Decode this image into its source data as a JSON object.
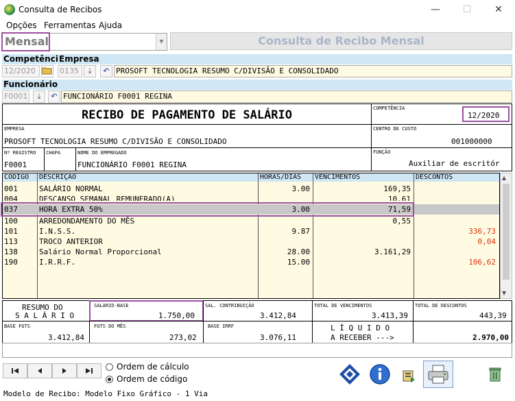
{
  "window": {
    "title": "Consulta de Recibos",
    "minimize": "—",
    "maximize": "☐",
    "close": "✕"
  },
  "menu": [
    "Opções",
    "Ferramentas",
    "Ajuda"
  ],
  "combo": {
    "value": "Mensal"
  },
  "banner": "Consulta de Recibo Mensal",
  "competencia": {
    "label": "Competência",
    "value": "12/2020"
  },
  "empresa": {
    "label": "Empresa",
    "code": "0135",
    "name": "PROSOFT TECNOLOGIA RESUMO C/DIVISÃO E CONSOLIDADO"
  },
  "funcionario": {
    "label": "Funcionário",
    "code": "F0001",
    "name": "FUNCIONÁRIO F0001 REGINA"
  },
  "recibo": {
    "title": "RECIBO DE PAGAMENTO DE SALÁRIO",
    "competencia_label": "COMPETÊNCIA",
    "competencia_value": "12/2020",
    "empresa_label": "EMPRESA",
    "empresa_value": "PROSOFT TECNOLOGIA RESUMO C/DIVISÃO E CONSOLIDADO",
    "centro_label": "CENTRO DE CUSTO",
    "centro_value": "001000000",
    "registro_label": "Nº REGISTRO",
    "registro_value": "F0001",
    "chapa_label": "CHAPA",
    "nome_label": "NOME DO EMPREGADO",
    "nome_value": "FUNCIONÁRIO F0001 REGINA",
    "funcao_label": "FUNÇÃO",
    "funcao_value": "Auxiliar de escritór"
  },
  "table": {
    "headers": [
      "CÓDIGO",
      "DESCRIÇÃO",
      "HORAS/DIAS",
      "VENCIMENTOS",
      "DESCONTOS"
    ],
    "rows": [
      [
        "001",
        "SALÁRIO NORMAL",
        "3.00",
        "169,35",
        ""
      ],
      [
        "004",
        "DESCANSO SEMANAL REMUNERADO(A)",
        "",
        "10,61",
        ""
      ],
      [
        "037",
        "HORA EXTRA 50%",
        "3.00",
        "71,59",
        ""
      ],
      [
        "100",
        "ARREDONDAMENTO DO MÊS",
        "",
        "0,55",
        ""
      ],
      [
        "101",
        "I.N.S.S.",
        "9.87",
        "",
        "336,73"
      ],
      [
        "113",
        "TROCO ANTERIOR",
        "",
        "",
        "0,04"
      ],
      [
        "138",
        "Salário Normal Proporcional",
        "28.00",
        "3.161,29",
        ""
      ],
      [
        "190",
        "I.R.R.F.",
        "15.00",
        "",
        "106,62"
      ]
    ]
  },
  "resumo": {
    "label_line1": "RESUMO DO",
    "label_line2": "S A L Á R I O",
    "salario_base_label": "SALÁRIO-BASE",
    "salario_base_value": "1.750,00",
    "sal_contrib_label": "SAL. CONTRIBUIÇÃO",
    "sal_contrib_value": "3.412,84",
    "total_venc_label": "TOTAL DE VENCIMENTOS",
    "total_venc_value": "3.413,39",
    "total_desc_label": "TOTAL DE DESCONTOS",
    "total_desc_value": "443,39",
    "base_fgts_label": "BASE FGTS",
    "base_fgts_value": "3.412,84",
    "fgts_mes_label": "FGTS DO MÊS",
    "fgts_mes_value": "273,02",
    "base_irrf_label": "BASE IRRF",
    "base_irrf_value": "3.076,11",
    "liquido_line1": "L Í Q U I D O",
    "liquido_line2": "A RECEBER --->",
    "liquido_value": "2.970,00"
  },
  "radios": {
    "calculo": "Ordem de cálculo",
    "codigo": "Ordem de código"
  },
  "status": "Modelo de Recibo: Modelo Fixo Gráfico - 1 Via",
  "colors": {
    "accent_highlight": "#9a4fa0",
    "header_blue": "#cfe6f5",
    "field_yellow": "#fffbe3",
    "discount_red": "#e0300a"
  }
}
